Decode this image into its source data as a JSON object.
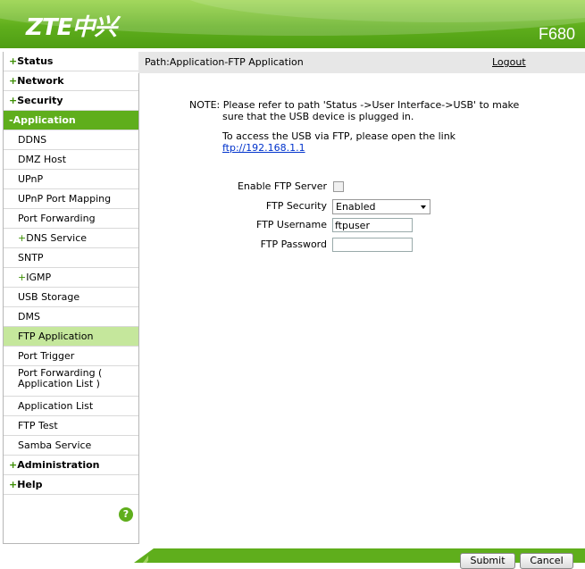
{
  "header": {
    "logo": "ZTE中兴",
    "model": "F680"
  },
  "sidebar": {
    "items": [
      {
        "label": "Status",
        "prefix": "+",
        "kind": "top"
      },
      {
        "label": "Network",
        "prefix": "+",
        "kind": "top"
      },
      {
        "label": "Security",
        "prefix": "+",
        "kind": "top"
      },
      {
        "label": "Application",
        "prefix": "-",
        "kind": "open"
      },
      {
        "label": "DDNS",
        "kind": "sub"
      },
      {
        "label": "DMZ Host",
        "kind": "sub"
      },
      {
        "label": "UPnP",
        "kind": "sub"
      },
      {
        "label": "UPnP Port Mapping",
        "kind": "sub"
      },
      {
        "label": "Port Forwarding",
        "kind": "sub"
      },
      {
        "label": "DNS Service",
        "prefix": "+",
        "kind": "sub"
      },
      {
        "label": "SNTP",
        "kind": "sub"
      },
      {
        "label": "IGMP",
        "prefix": "+",
        "kind": "sub"
      },
      {
        "label": "USB Storage",
        "kind": "sub"
      },
      {
        "label": "DMS",
        "kind": "sub"
      },
      {
        "label": "FTP Application",
        "kind": "sub",
        "active": true
      },
      {
        "label": "Port Trigger",
        "kind": "sub"
      },
      {
        "label": "Port Forwarding ( Application List )",
        "kind": "sub",
        "tall": true
      },
      {
        "label": "Application List",
        "kind": "sub"
      },
      {
        "label": "FTP Test",
        "kind": "sub"
      },
      {
        "label": "Samba Service",
        "kind": "sub"
      },
      {
        "label": "Administration",
        "prefix": "+",
        "kind": "top"
      },
      {
        "label": "Help",
        "prefix": "+",
        "kind": "top"
      }
    ],
    "help_icon": "?"
  },
  "pathbar": {
    "path": "Path:Application-FTP Application",
    "logout": "Logout"
  },
  "note": {
    "line1": "NOTE: Please refer to path 'Status ->User Interface->USB' to make",
    "line2": "sure that the USB device is plugged in.",
    "access_text": "To access the USB via FTP, please open the link",
    "access_link": "ftp://192.168.1.1"
  },
  "form": {
    "enable_label": "Enable FTP Server",
    "enable_checked": false,
    "security_label": "FTP Security",
    "security_value": "Enabled",
    "username_label": "FTP Username",
    "username_value": "ftpuser",
    "password_label": "FTP Password",
    "password_value": ""
  },
  "buttons": {
    "submit": "Submit",
    "cancel": "Cancel"
  },
  "colors": {
    "brand_green": "#5fae1c",
    "active_item": "#c5e79c",
    "link": "#0033cc"
  }
}
